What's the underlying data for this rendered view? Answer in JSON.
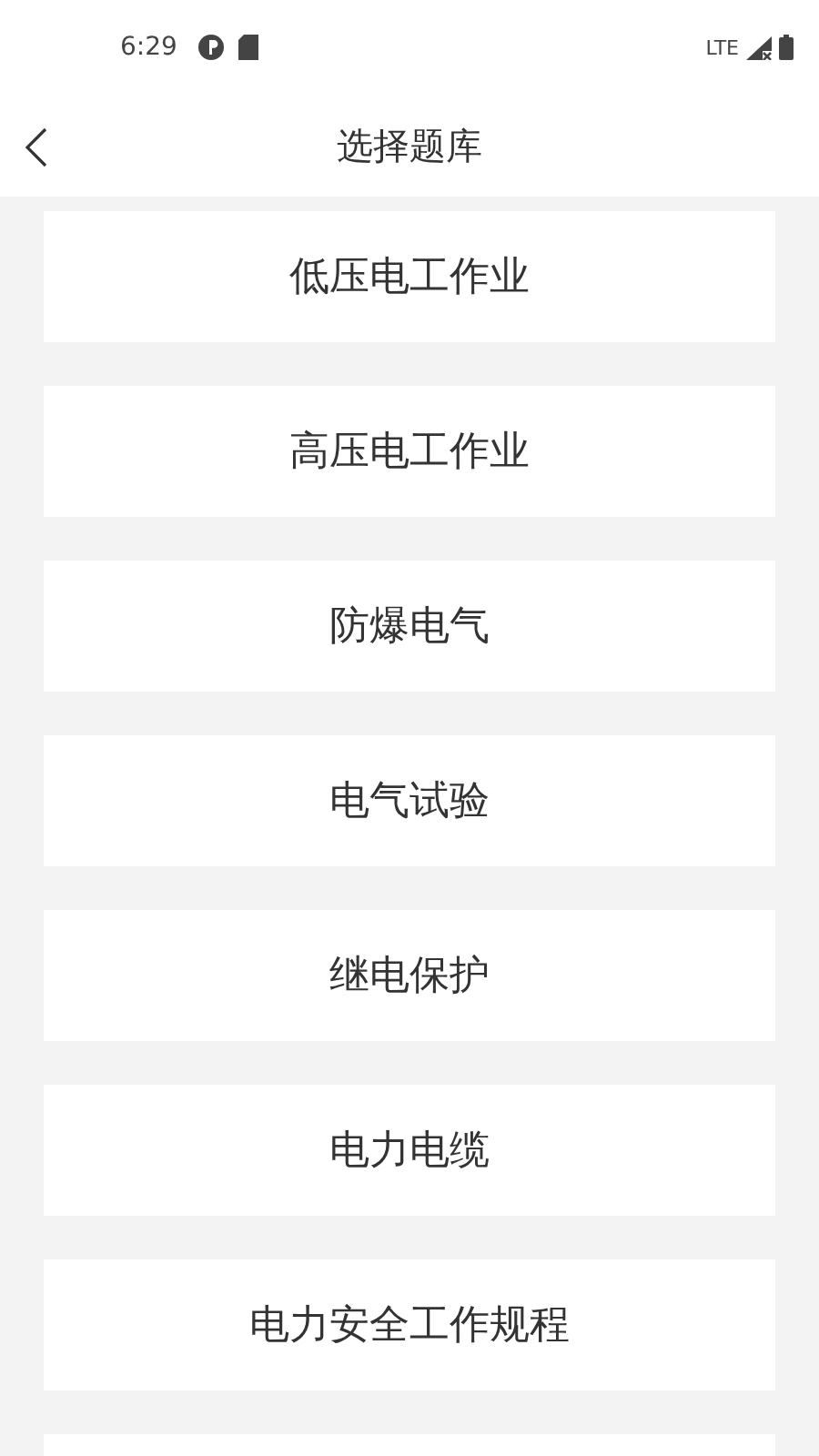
{
  "status_bar": {
    "time": "6:29",
    "network": "LTE"
  },
  "header": {
    "title": "选择题库"
  },
  "items": [
    {
      "label": "低压电工作业"
    },
    {
      "label": "高压电工作业"
    },
    {
      "label": "防爆电气"
    },
    {
      "label": "电气试验"
    },
    {
      "label": "继电保护"
    },
    {
      "label": "电力电缆"
    },
    {
      "label": "电力安全工作规程"
    }
  ]
}
